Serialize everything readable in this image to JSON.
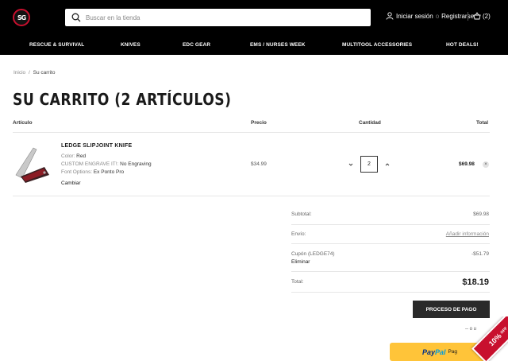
{
  "header": {
    "logo_text": "SG",
    "search_placeholder": "Buscar en la tienda",
    "login": "Iniciar sesión",
    "or": "o",
    "register": "Registrarse",
    "cart_count": "(2)"
  },
  "nav": {
    "items": [
      "RESCUE & SURVIVAL",
      "KNIVES",
      "EDC GEAR",
      "EMS / NURSES WEEK",
      "MULTITOOL ACCESSORIES",
      "HOT DEALS!"
    ]
  },
  "breadcrumb": {
    "home": "Inicio",
    "separator": "/",
    "current": "Su carrito"
  },
  "page_title": "SU CARRITO (2 ARTÍCULOS)",
  "table": {
    "headers": {
      "item": "Artículo",
      "price": "Precio",
      "qty": "Cantidad",
      "total": "Total"
    }
  },
  "line_item": {
    "name": "LEDGE SLIPJOINT KNIFE",
    "options": [
      {
        "label": "Color:",
        "value": "Red"
      },
      {
        "label": "CUSTOM ENGRAVE IT!:",
        "value": "No Engraving"
      },
      {
        "label": "Font Options:",
        "value": "Ex Ponto Pro"
      }
    ],
    "change": "Cambiar",
    "price": "$34.99",
    "quantity": "2",
    "total": "$69.98",
    "remove_glyph": "×"
  },
  "summary": {
    "subtotal_label": "Subtotal:",
    "subtotal_value": "$69.98",
    "shipping_label": "Envío:",
    "shipping_value": "Añadir información",
    "coupon_label": "Cupón (LEDGE74)",
    "coupon_value": "-$51.79",
    "coupon_remove": "Eliminar",
    "total_label": "Total:",
    "total_value": "$18.19"
  },
  "checkout_button": "PROCESO DE PAGO",
  "or_divider": "-- o u",
  "paypal": {
    "pay": "Pay",
    "pal": "Pal",
    "suffix": "Pag"
  },
  "promo": {
    "text": "10%",
    "sub": "OFF"
  },
  "colors": {
    "accent": "#c8102e",
    "header_bg": "#000000",
    "paypal": "#ffc439"
  }
}
